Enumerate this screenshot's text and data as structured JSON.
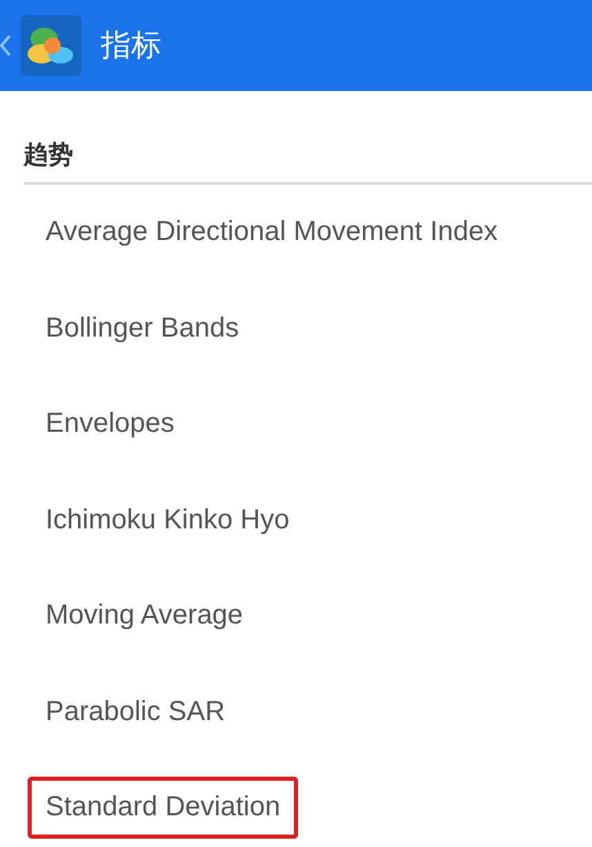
{
  "app_bar": {
    "title": "指标"
  },
  "section": {
    "title": "趋势"
  },
  "items": [
    {
      "label": "Average Directional Movement Index",
      "highlighted": false
    },
    {
      "label": "Bollinger Bands",
      "highlighted": false
    },
    {
      "label": "Envelopes",
      "highlighted": false
    },
    {
      "label": "Ichimoku Kinko Hyo",
      "highlighted": false
    },
    {
      "label": "Moving Average",
      "highlighted": false
    },
    {
      "label": "Parabolic SAR",
      "highlighted": false
    },
    {
      "label": "Standard Deviation",
      "highlighted": true
    }
  ]
}
